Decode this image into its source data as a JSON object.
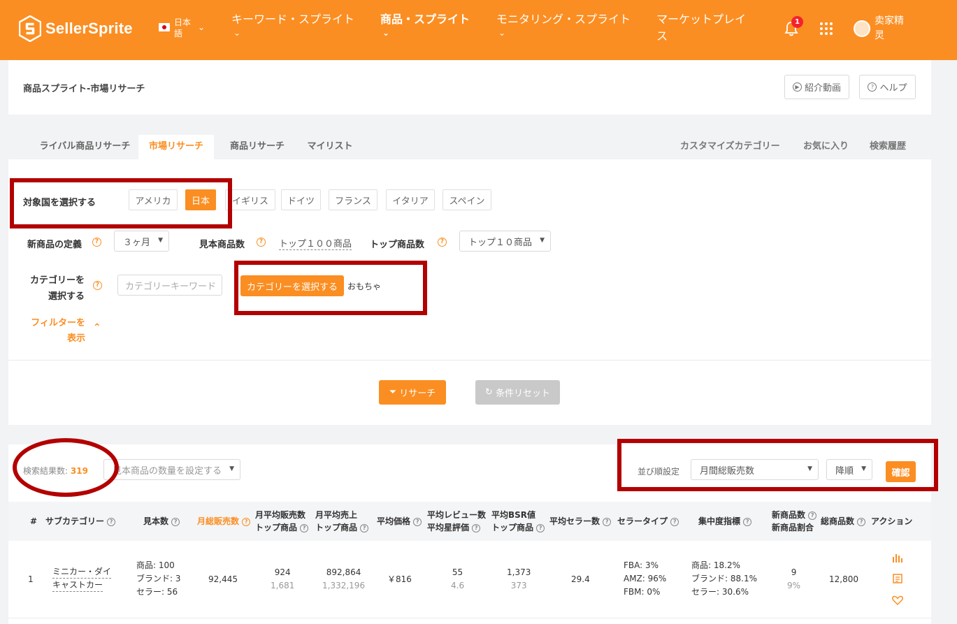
{
  "brand": {
    "name": "SellerSprite",
    "accent": "#fb8e22",
    "annotation_color": "#b30000"
  },
  "header": {
    "language": "日本語",
    "nav": [
      {
        "label": "キーワード・スプライト"
      },
      {
        "label": "商品・スプライト"
      },
      {
        "label": "モニタリング・スプライト"
      },
      {
        "label": "マーケットプレイス"
      }
    ],
    "notification_count": "1",
    "user_name": "卖家精灵"
  },
  "page": {
    "title": "商品スプライト-市場リサーチ",
    "intro_video": "紹介動画",
    "help": "ヘルプ"
  },
  "tabs": {
    "left": [
      "ライバル商品リサーチ",
      "市場リサーチ",
      "商品リサーチ",
      "マイリスト"
    ],
    "right": [
      "カスタマイズカテゴリー",
      "お気に入り",
      "検索履歴"
    ],
    "active": "市場リサーチ"
  },
  "filters": {
    "country_label": "対象国を選択する",
    "countries": [
      "アメリカ",
      "日本",
      "イギリス",
      "ドイツ",
      "フランス",
      "イタリア",
      "スペイン"
    ],
    "selected_country": "日本",
    "new_product_label": "新商品の定義",
    "new_product_value": "３ヶ月",
    "sample_label": "見本商品数",
    "sample_value": "トップ１００商品",
    "top_label": "トップ商品数",
    "top_value": "トップ１０商品",
    "category_label_1": "カテゴリーを",
    "category_label_2": "選択する",
    "category_placeholder": "カテゴリーキーワード",
    "category_button": "カテゴリーを選択する",
    "category_selected": "おもちゃ",
    "show_filter_1": "フィルターを",
    "show_filter_2": "表示",
    "search_button": "リサーチ",
    "reset_button": "条件リセット",
    "help_mark": "?"
  },
  "results": {
    "count_label": "検索結果数:",
    "count": "319",
    "sample_placeholder": "見本商品の数量を設定する",
    "sort_label": "並び順設定",
    "sort_field": "月間総販売数",
    "sort_order": "降順",
    "confirm": "確認",
    "columns": {
      "index": "#",
      "subcategory": "サブカテゴリー",
      "samples": "見本数",
      "monthly_sales": "月総販売数",
      "avg_sales_1": "月平均販売数",
      "avg_sales_2": "トップ商品",
      "avg_revenue_1": "月平均売上",
      "avg_revenue_2": "トップ商品",
      "avg_price": "平均価格",
      "avg_review_1": "平均レビュー数",
      "avg_review_2": "平均星評価",
      "avg_bsr_1": "平均BSR値",
      "avg_bsr_2": "トップ商品",
      "avg_sellers": "平均セラー数",
      "seller_type": "セラータイプ",
      "concentration": "集中度指標",
      "new_count_1": "新商品数",
      "new_count_2": "新商品割合",
      "total": "総商品数",
      "action": "アクション"
    },
    "rows": [
      {
        "index": "1",
        "subcategory_1": "ミニカー・ダイ",
        "subcategory_2": "キャストカー",
        "samples_products": "商品: 100",
        "samples_brands": "ブランド: 3",
        "samples_sellers": "セラー: 56",
        "monthly_sales": "92,445",
        "avg_sales": "924",
        "avg_sales_top": "1,681",
        "avg_revenue": "892,864",
        "avg_revenue_top": "1,332,196",
        "avg_price": "￥816",
        "avg_reviews": "55",
        "avg_rating": "4.6",
        "avg_bsr": "1,373",
        "avg_bsr_top": "373",
        "avg_sellers": "29.4",
        "fba": "FBA: 3%",
        "amz": "AMZ: 96%",
        "fbm": "FBM: 0%",
        "conc_products": "商品: 18.2%",
        "conc_brands": "ブランド: 88.1%",
        "conc_sellers": "セラー: 30.6%",
        "new_count": "9",
        "new_ratio": "9%",
        "total": "12,800"
      }
    ]
  }
}
